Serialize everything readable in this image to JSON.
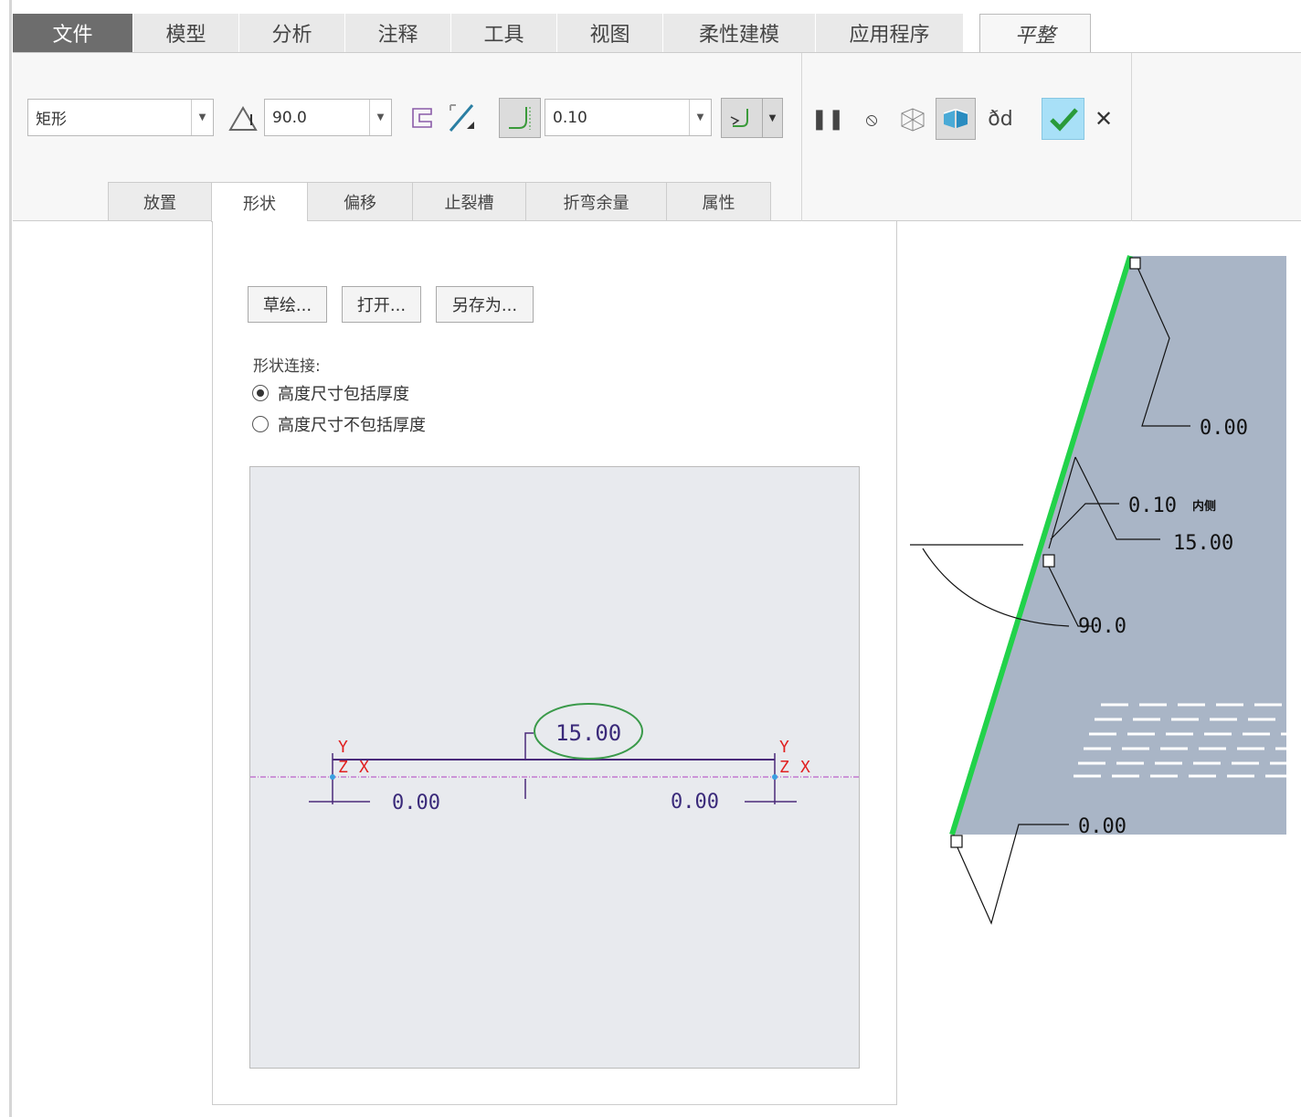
{
  "tabs": [
    {
      "label": "文件"
    },
    {
      "label": "模型"
    },
    {
      "label": "分析"
    },
    {
      "label": "注释"
    },
    {
      "label": "工具"
    },
    {
      "label": "视图"
    },
    {
      "label": "柔性建模"
    },
    {
      "label": "应用程序"
    },
    {
      "label": "平整"
    }
  ],
  "toolbar": {
    "shape_select": "矩形",
    "angle_value": "90.0",
    "radius_value": "0.10"
  },
  "subtabs": [
    {
      "label": "放置"
    },
    {
      "label": "形状"
    },
    {
      "label": "偏移"
    },
    {
      "label": "止裂槽"
    },
    {
      "label": "折弯余量"
    },
    {
      "label": "属性"
    }
  ],
  "shape_panel": {
    "sketch_button": "草绘...",
    "open_button": "打开...",
    "save_as_button": "另存为...",
    "connection_label": "形状连接:",
    "options": [
      {
        "label": "高度尺寸包括厚度",
        "selected": true
      },
      {
        "label": "高度尺寸不包括厚度",
        "selected": false
      }
    ]
  },
  "sketch": {
    "height_dim": "15.00",
    "left_offset": "0.00",
    "right_offset": "0.00",
    "axis_y": "Y",
    "axis_z": "Z",
    "axis_x": "X"
  },
  "model": {
    "top_offset": "0.00",
    "radius_label": "0.10",
    "radius_side": "内侧",
    "height": "15.00",
    "angle": "90.0",
    "bottom_offset": "0.00"
  },
  "colors": {
    "accent_green": "#22d24a",
    "model_face": "#a9b5c6",
    "confirm_bg": "#a8e0f7"
  }
}
